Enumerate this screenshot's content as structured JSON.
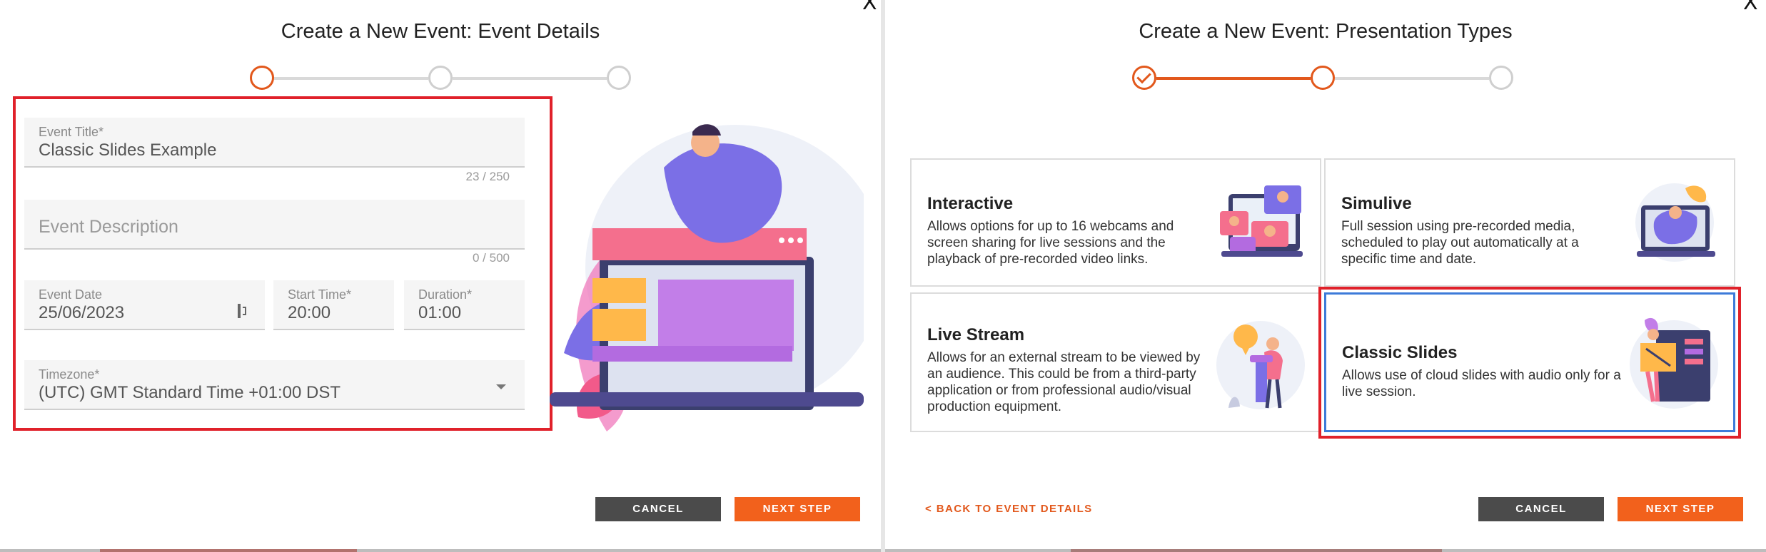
{
  "left_dialog": {
    "close_label": "X",
    "title": "Create a New Event: Event Details",
    "form": {
      "event_title": {
        "label": "Event Title*",
        "value": "Classic Slides Example",
        "counter": "23 / 250"
      },
      "event_description": {
        "placeholder": "Event Description",
        "counter": "0 / 500"
      },
      "event_date": {
        "label": "Event Date",
        "value": "25/06/2023"
      },
      "start_time": {
        "label": "Start Time*",
        "value": "20:00"
      },
      "duration": {
        "label": "Duration*",
        "value": "01:00"
      },
      "timezone": {
        "label": "Timezone*",
        "value": "(UTC) GMT Standard Time +01:00 DST"
      }
    },
    "cancel_label": "CANCEL",
    "next_label": "NEXT STEP"
  },
  "right_dialog": {
    "close_label": "X",
    "title": "Create a New Event: Presentation Types",
    "cards": [
      {
        "title": "Interactive",
        "description": "Allows options for up to 16 webcams and screen sharing for live sessions and the playback of pre-recorded video links."
      },
      {
        "title": "Simulive",
        "description": "Full session using pre-recorded media, scheduled to play out automatically at a specific time and date."
      },
      {
        "title": "Live Stream",
        "description": "Allows for an external stream to be viewed by an audience. This could be from a third-party application or from professional audio/visual production equipment."
      },
      {
        "title": "Classic Slides",
        "description": "Allows use of cloud slides with audio only for a live session."
      }
    ],
    "back_label": "< BACK TO EVENT DETAILS",
    "cancel_label": "CANCEL",
    "next_label": "NEXT STEP"
  },
  "icons": {
    "calendar": "calendar-icon",
    "dropdown": "chevron-down-icon",
    "checkmark": "check-icon"
  },
  "colors": {
    "accent_orange": "#f2611c",
    "step_orange": "#e2581c",
    "highlight_red": "#e0212a",
    "selected_blue": "#3d7bd9",
    "dark_button": "#4b4b4b"
  }
}
